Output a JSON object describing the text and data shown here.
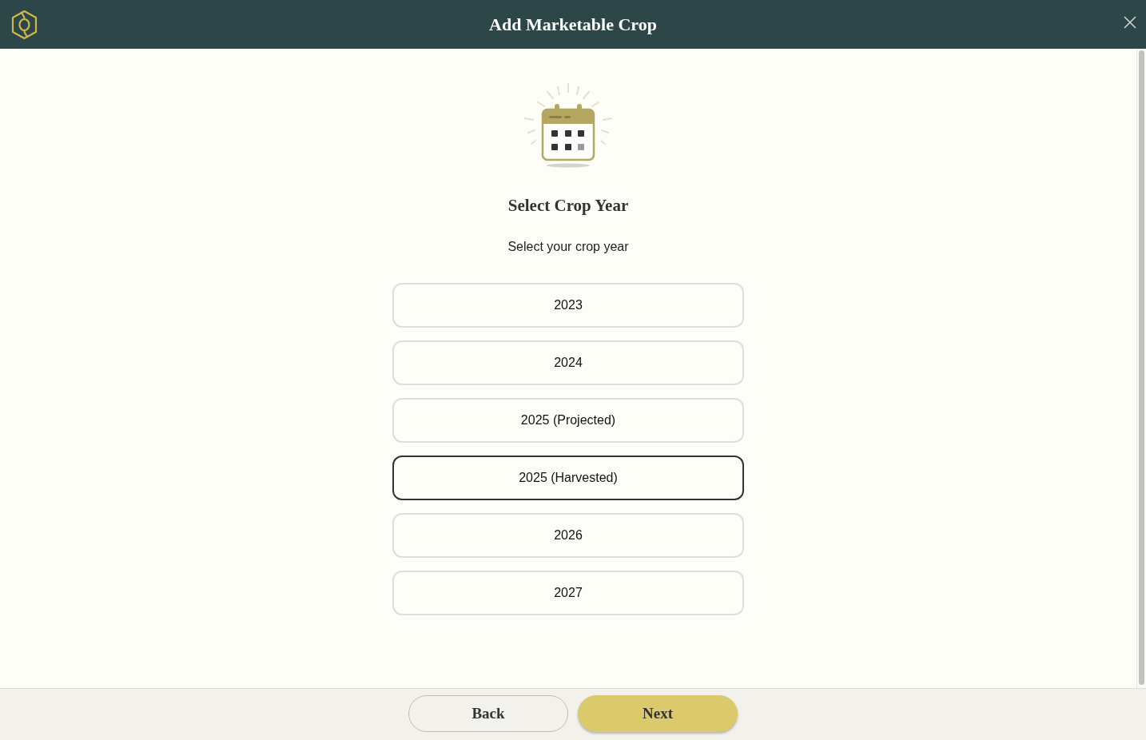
{
  "dialog": {
    "title": "Add Marketable Crop"
  },
  "step": {
    "title": "Select Crop Year",
    "subtitle": "Select your crop year"
  },
  "options": [
    {
      "label": "2023",
      "selected": false
    },
    {
      "label": "2024",
      "selected": false
    },
    {
      "label": "2025 (Projected)",
      "selected": false
    },
    {
      "label": "2025 (Harvested)",
      "selected": true
    },
    {
      "label": "2026",
      "selected": false
    },
    {
      "label": "2027",
      "selected": false
    }
  ],
  "footer": {
    "buttons": [
      {
        "label": "Back",
        "kind": "secondary"
      },
      {
        "label": "Next",
        "kind": "primary"
      }
    ]
  }
}
